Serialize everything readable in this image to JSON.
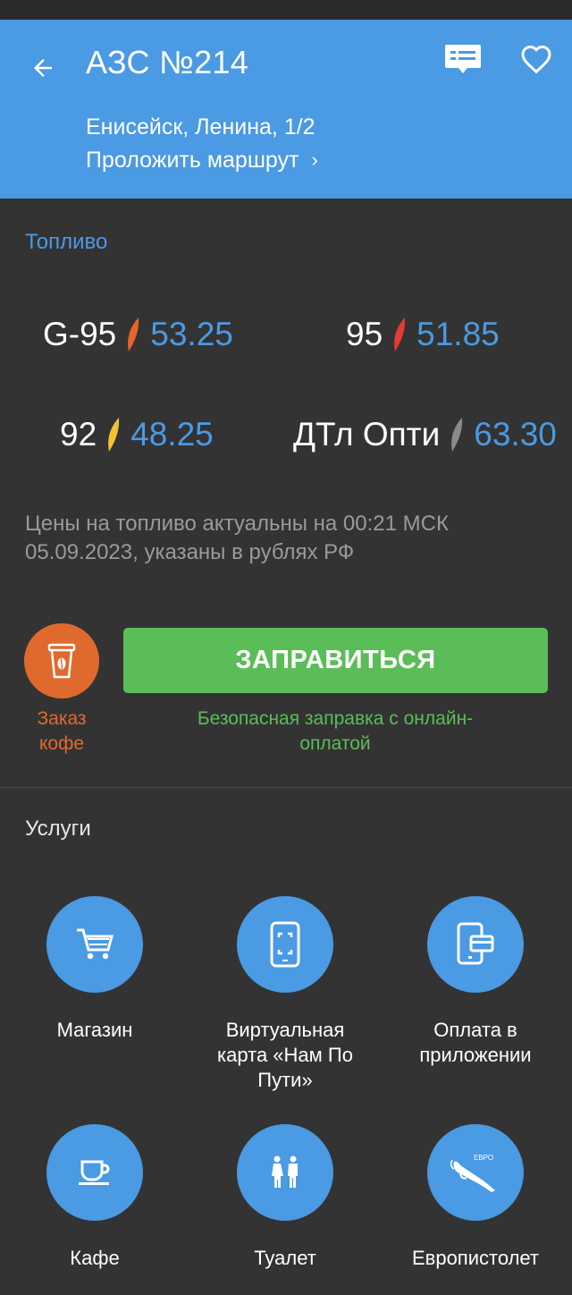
{
  "header": {
    "title": "АЗС №214",
    "address": "Енисейск, Ленина, 1/2",
    "route_label": "Проложить маршрут",
    "route_chevron": "›"
  },
  "fuel": {
    "section_title": "Топливо",
    "items": [
      {
        "name": "G-95",
        "price": "53.25",
        "drop_color": "#e8642a"
      },
      {
        "name": "95",
        "price": "51.85",
        "drop_color": "#e53935"
      },
      {
        "name": "92",
        "price": "48.25",
        "drop_color": "#f2c230"
      },
      {
        "name": "ДТл Опти",
        "price": "63.30",
        "drop_color": "#8a8a8a"
      }
    ],
    "note": "Цены на топливо актуальны на 00:21 МСК 05.09.2023, указаны в рублях РФ"
  },
  "actions": {
    "coffee_label": "Заказ кофе",
    "fill_label": "ЗАПРАВИТЬСЯ",
    "fill_note": "Безопасная заправка с онлайн-оплатой"
  },
  "services": {
    "section_title": "Услуги",
    "items": [
      {
        "label": "Магазин",
        "icon": "cart-icon"
      },
      {
        "label": "Виртуальная карта «Нам По Пути»",
        "icon": "phone-card-icon"
      },
      {
        "label": "Оплата в приложении",
        "icon": "phone-payment-icon"
      },
      {
        "label": "Кафе",
        "icon": "cup-icon"
      },
      {
        "label": "Туалет",
        "icon": "toilet-icon"
      },
      {
        "label": "Европистолет",
        "icon": "nozzle-icon",
        "icon_text": "ЕВРО"
      }
    ]
  },
  "colors": {
    "accent_blue": "#4a9ae4",
    "green": "#5bbd57",
    "orange": "#e06a2e",
    "background": "#333333"
  }
}
